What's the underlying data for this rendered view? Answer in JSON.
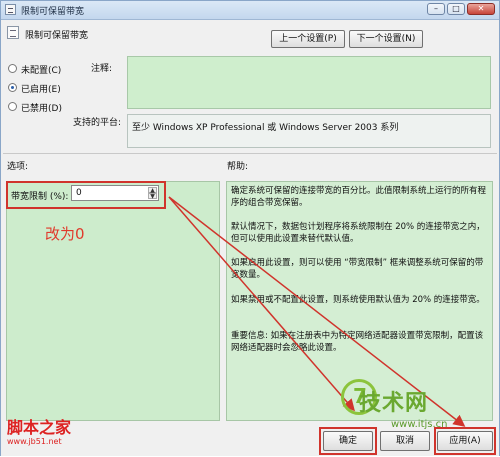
{
  "window": {
    "title": "限制可保留带宽",
    "controls": {
      "minimize": "–",
      "maximize": "□",
      "close": "✕"
    }
  },
  "header": {
    "title": "限制可保留带宽",
    "prev_button": "上一个设置(P)",
    "next_button": "下一个设置(N)"
  },
  "state": {
    "options": [
      "未配置(C)",
      "已启用(E)",
      "已禁用(D)"
    ],
    "selected_index": 1
  },
  "comment": {
    "label": "注释:",
    "value": ""
  },
  "platform": {
    "label": "支持的平台:",
    "value": "至少 Windows XP Professional 或 Windows Server 2003 系列"
  },
  "options_section": {
    "label": "选项:",
    "bandwidth_label": "带宽限制 (%):",
    "bandwidth_value": "0",
    "annotation": "改为0"
  },
  "help": {
    "label": "帮助:",
    "paragraphs": [
      "确定系统可保留的连接带宽的百分比。此值限制系统上运行的所有程序的组合带宽保留。",
      "默认情况下，数据包计划程序将系统限制在 20% 的连接带宽之内，但可以使用此设置来替代默认值。",
      "如果启用此设置，则可以使用 “带宽限制” 框来调整系统可保留的带宽数量。",
      "如果禁用或不配置此设置，则系统使用默认值为 20% 的连接带宽。",
      "重要信息: 如果在注册表中为特定网络适配器设置带宽限制，配置该网络适配器时会忽略此设置。"
    ]
  },
  "footer": {
    "ok_button": "确定",
    "cancel_button": "取消",
    "apply_button": "应用(A)"
  },
  "watermarks": {
    "left": "脚本之家",
    "left_url": "www.jb51.net",
    "right": "技术网",
    "right_url": "www.itjs.cn"
  },
  "colors": {
    "annotation_red": "#d0342c",
    "panel_green": "#cdeccc",
    "watermark_green": "#6aa830"
  }
}
